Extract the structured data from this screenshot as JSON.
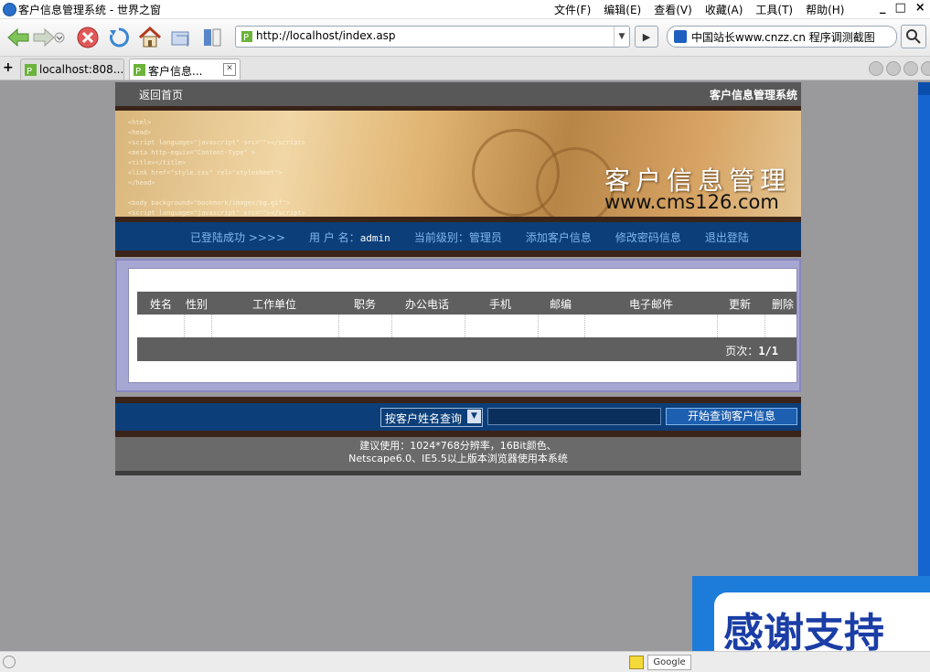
{
  "window": {
    "title": "客户信息管理系统 - 世界之窗",
    "menus": [
      "文件(F)",
      "编辑(E)",
      "查看(V)",
      "收藏(A)",
      "工具(T)",
      "帮助(H)"
    ],
    "controls": [
      "_",
      "□",
      "×"
    ]
  },
  "toolbar": {
    "address": "http://localhost/index.asp",
    "search_engine": "中国站长www.cnzz.cn 程序调测截图"
  },
  "tabs": [
    {
      "label": "localhost:808..."
    },
    {
      "label": "客户信息..."
    }
  ],
  "page": {
    "home_link": "返回首页",
    "system_title": "客户信息管理系统",
    "banner_title": "客户信息管理",
    "banner_url": "www.cms126.com",
    "nav": {
      "login_ok": "已登陆成功 >>>>",
      "user_label": "用 户 名：",
      "username": "admin",
      "level": "当前级别：管理员",
      "add": "添加客户信息",
      "change_pwd": "修改密码信息",
      "logout": "退出登陆"
    },
    "table": {
      "headers": [
        "姓名",
        "性别",
        "工作单位",
        "职务",
        "办公电话",
        "手机",
        "邮编",
        "电子邮件",
        "更新",
        "删除"
      ],
      "pager_label": "页次：",
      "pager_value": "1/1"
    },
    "query": {
      "select_value": "按客户姓名查询",
      "input_value": "",
      "button": "开始查询客户信息"
    },
    "footer": {
      "line1": "建议使用：1024*768分辨率，16Bit颜色、",
      "line2": "Netscape6.0、IE5.5以上版本浏览器使用本系统"
    }
  },
  "overlay": {
    "text": "感谢支持"
  },
  "status": {
    "google": "Google"
  },
  "colors": {
    "nav_blue": "#0c3f79",
    "link_blue": "#7fb6ee",
    "header_gray": "#5f5f5f"
  }
}
